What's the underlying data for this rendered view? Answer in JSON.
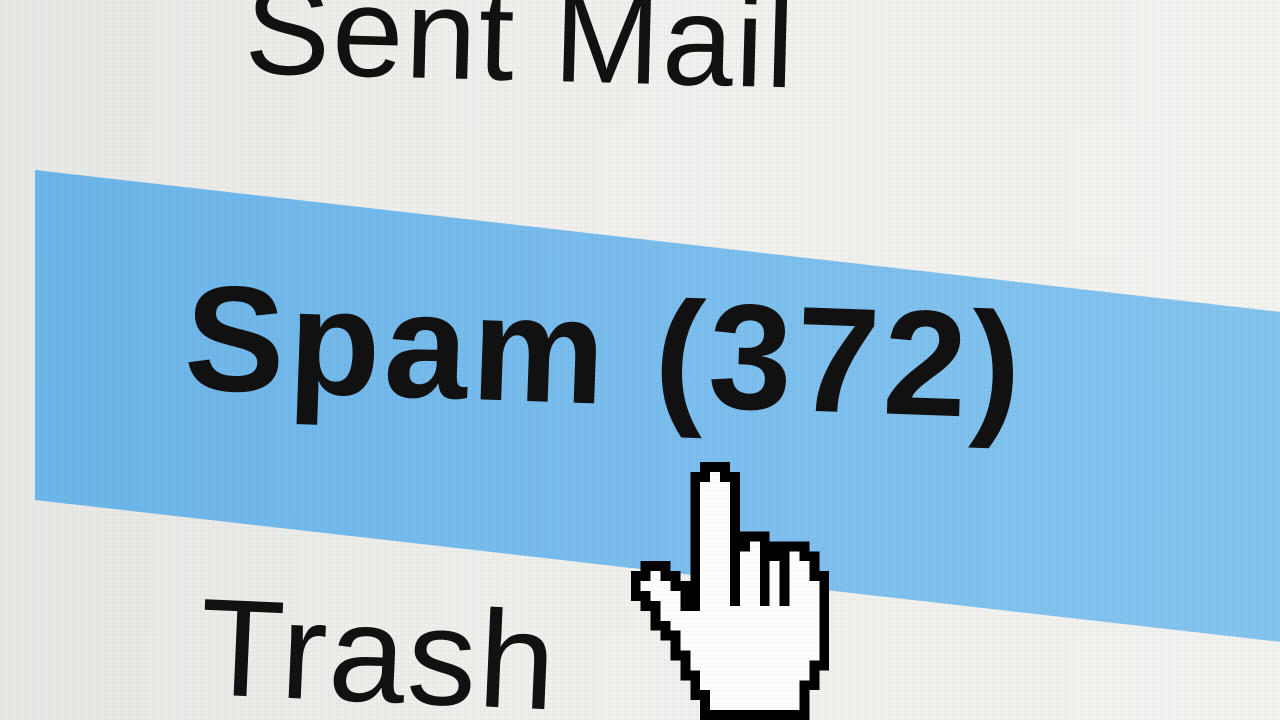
{
  "folders": {
    "sent": {
      "label": "Sent Mail"
    },
    "spam": {
      "label": "Spam (372)"
    },
    "trash": {
      "label": "Trash"
    }
  },
  "selected_folder": "spam",
  "colors": {
    "highlight": "#7ec0ee",
    "text": "#111111",
    "background": "#f0f0ed"
  },
  "cursor": {
    "icon": "pointing-hand-cursor-icon"
  }
}
